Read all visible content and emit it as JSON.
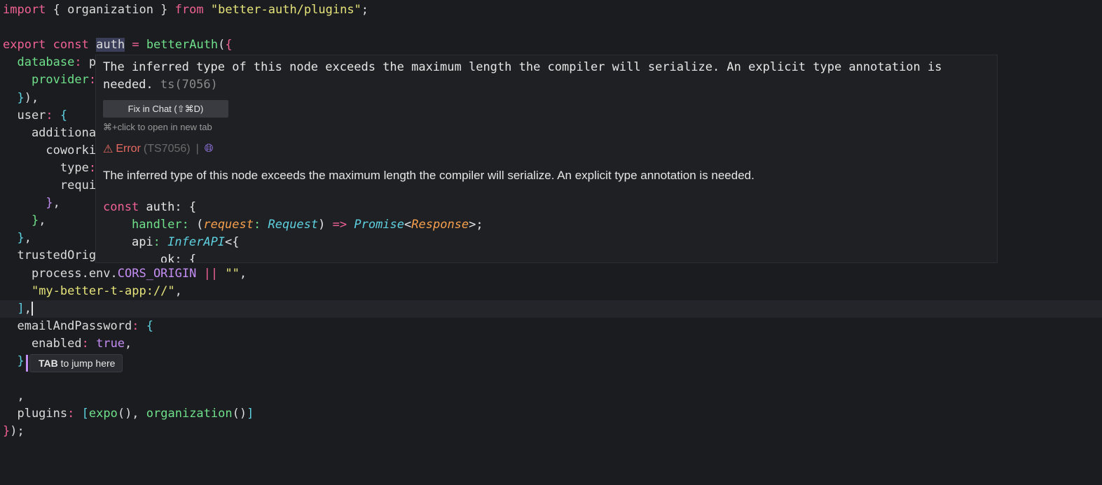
{
  "editor": {
    "lines": [
      {
        "tokens": [
          [
            "kw",
            "import"
          ],
          [
            "punc",
            " { organization } "
          ],
          [
            "kw",
            "from"
          ],
          [
            "punc",
            " "
          ],
          [
            "str",
            "\"better-auth/plugins\""
          ],
          [
            "punc",
            ";"
          ]
        ]
      },
      {
        "tokens": []
      },
      {
        "tokens": [
          [
            "kw",
            "export"
          ],
          [
            "punc",
            " "
          ],
          [
            "kw",
            "const"
          ],
          [
            "punc",
            " "
          ],
          [
            "hl",
            "auth"
          ],
          [
            "punc",
            " "
          ],
          [
            "op",
            "="
          ],
          [
            "punc",
            " "
          ],
          [
            "fn",
            "betterAuth"
          ],
          [
            "punc",
            "("
          ],
          [
            "bracket-pink",
            "{"
          ]
        ]
      },
      {
        "tokens": [
          [
            "punc",
            "  "
          ],
          [
            "prop",
            "database"
          ],
          [
            "op",
            ":"
          ],
          [
            "punc",
            " p"
          ]
        ]
      },
      {
        "tokens": [
          [
            "punc",
            "    "
          ],
          [
            "prop",
            "provider"
          ],
          [
            "op",
            ":"
          ]
        ]
      },
      {
        "tokens": [
          [
            "punc",
            "  "
          ],
          [
            "brace",
            "}"
          ],
          [
            "punc",
            "),"
          ]
        ]
      },
      {
        "tokens": [
          [
            "punc",
            "  user"
          ],
          [
            "op",
            ":"
          ],
          [
            "punc",
            " "
          ],
          [
            "brace",
            "{"
          ]
        ]
      },
      {
        "tokens": [
          [
            "punc",
            "    additiona"
          ]
        ]
      },
      {
        "tokens": [
          [
            "punc",
            "      coworki"
          ]
        ]
      },
      {
        "tokens": [
          [
            "punc",
            "        type"
          ],
          [
            "op",
            ":"
          ]
        ]
      },
      {
        "tokens": [
          [
            "punc",
            "        requi"
          ]
        ]
      },
      {
        "tokens": [
          [
            "punc",
            "      "
          ],
          [
            "const",
            "}"
          ],
          [
            "punc",
            ","
          ]
        ]
      },
      {
        "tokens": [
          [
            "punc",
            "    "
          ],
          [
            "prop",
            "}"
          ],
          [
            "punc",
            ","
          ]
        ]
      },
      {
        "tokens": [
          [
            "punc",
            "  "
          ],
          [
            "brace",
            "}"
          ],
          [
            "punc",
            ","
          ]
        ]
      },
      {
        "tokens": [
          [
            "punc",
            "  trustedOrig"
          ]
        ]
      },
      {
        "tokens": [
          [
            "punc",
            "    process.env."
          ],
          [
            "env",
            "CORS_ORIGIN"
          ],
          [
            "punc",
            " "
          ],
          [
            "op",
            "||"
          ],
          [
            "punc",
            " "
          ],
          [
            "str",
            "\"\""
          ],
          [
            "punc",
            ","
          ]
        ]
      },
      {
        "tokens": [
          [
            "punc",
            "    "
          ],
          [
            "str",
            "\"my-better-t-app://\""
          ],
          [
            "punc",
            ","
          ]
        ]
      },
      {
        "tokens": [
          [
            "punc",
            "  "
          ],
          [
            "brace",
            "]"
          ],
          [
            "punc",
            ","
          ]
        ],
        "active": true,
        "cursor": true
      },
      {
        "tokens": [
          [
            "punc",
            "  emailAndPassword"
          ],
          [
            "op",
            ":"
          ],
          [
            "punc",
            " "
          ],
          [
            "brace",
            "{"
          ]
        ]
      },
      {
        "tokens": [
          [
            "punc",
            "    enabled"
          ],
          [
            "op",
            ":"
          ],
          [
            "punc",
            " "
          ],
          [
            "const",
            "true"
          ],
          [
            "punc",
            ","
          ]
        ]
      },
      {
        "tokens": [
          [
            "punc",
            "  "
          ],
          [
            "brace",
            "}"
          ]
        ]
      },
      {
        "tokens": []
      },
      {
        "tokens": [
          [
            "punc",
            "  ,"
          ]
        ]
      },
      {
        "tokens": [
          [
            "punc",
            "  plugins"
          ],
          [
            "op",
            ":"
          ],
          [
            "punc",
            " "
          ],
          [
            "brace",
            "["
          ],
          [
            "fn",
            "expo"
          ],
          [
            "punc",
            "(), "
          ],
          [
            "fn",
            "organization"
          ],
          [
            "punc",
            "()"
          ],
          [
            "brace",
            "]"
          ]
        ]
      },
      {
        "tokens": [
          [
            "bracket-pink",
            "}"
          ],
          [
            "punc",
            ");"
          ]
        ]
      }
    ]
  },
  "popup": {
    "message_line1": "The inferred type of this node exceeds the maximum length the compiler will serialize. An explicit type annotation is",
    "message_line2": "needed.",
    "message_code": "ts(7056)",
    "fix_button": "Fix in Chat (⇧⌘D)",
    "open_hint": "⌘+click to open in new tab",
    "error_label": "Error",
    "error_code": "(TS7056)",
    "separator": "|",
    "description": "The inferred type of this node exceeds the maximum length the compiler will serialize. An explicit type annotation is needed.",
    "type_preview": {
      "l1_kw": "const",
      "l1_rest": " auth: {",
      "l2_prop": "handler",
      "l2_param": "request",
      "l2_type": "Request",
      "l2_arrow": "=>",
      "l2_promise": "Promise",
      "l2_resp": "Response",
      "l3_prop": "api",
      "l3_type": "InferAPI",
      "l4": "        ok: {"
    }
  },
  "tab_hint": {
    "key": "TAB",
    "text": "to jump here"
  },
  "colors": {
    "background": "#1b1c20",
    "keyword": "#f06292",
    "string": "#e6e37a",
    "function": "#6fe08a",
    "error": "#e86b62",
    "accent": "#c38df2"
  }
}
